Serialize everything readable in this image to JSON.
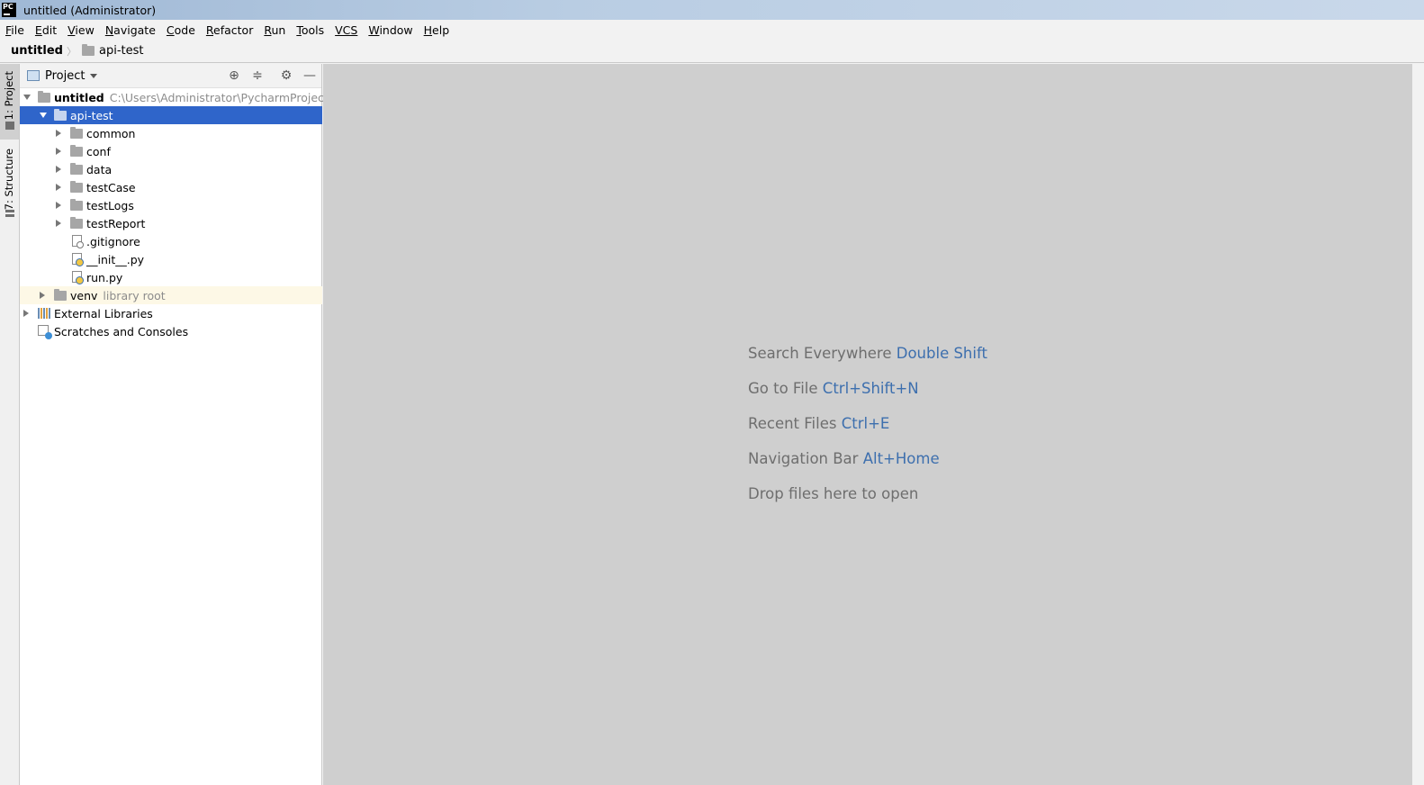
{
  "window": {
    "title": "untitled (Administrator)",
    "logo_text": "PC"
  },
  "menu": [
    {
      "mnemonic": "F",
      "rest": "ile"
    },
    {
      "mnemonic": "E",
      "rest": "dit"
    },
    {
      "mnemonic": "V",
      "rest": "iew"
    },
    {
      "mnemonic": "N",
      "rest": "avigate"
    },
    {
      "mnemonic": "C",
      "rest": "ode"
    },
    {
      "mnemonic": "R",
      "rest": "efactor"
    },
    {
      "mnemonic": "R",
      "rest": "un"
    },
    {
      "mnemonic": "T",
      "rest": "ools"
    },
    {
      "mnemonic": "VCS",
      "rest": ""
    },
    {
      "mnemonic": "W",
      "rest": "indow"
    },
    {
      "mnemonic": "H",
      "rest": "elp"
    }
  ],
  "breadcrumb": {
    "root": "untitled",
    "child": "api-test"
  },
  "toolstrip": {
    "project_tab": "1: Project",
    "structure_tab": "7: Structure"
  },
  "project_panel": {
    "title": "Project",
    "tree": {
      "root": {
        "label": "untitled",
        "path": "C:\\Users\\Administrator\\PycharmProjects\\u"
      },
      "selected": "api-test",
      "folders": [
        "common",
        "conf",
        "data",
        "testCase",
        "testLogs",
        "testReport"
      ],
      "files": [
        ".gitignore",
        "__init__.py",
        "run.py"
      ],
      "venv": {
        "label": "venv",
        "hint": "library root"
      },
      "external_libraries": "External Libraries",
      "scratches": "Scratches and Consoles"
    }
  },
  "editor_hints": [
    {
      "text": "Search Everywhere",
      "key": "Double Shift"
    },
    {
      "text": "Go to File",
      "key": "Ctrl+Shift+N"
    },
    {
      "text": "Recent Files",
      "key": "Ctrl+E"
    },
    {
      "text": "Navigation Bar",
      "key": "Alt+Home"
    },
    {
      "text": "Drop files here to open",
      "key": ""
    }
  ],
  "colors": {
    "selection": "#2f65ca",
    "hint_key": "#3d6fae",
    "editor_bg": "#cfcfcf"
  }
}
